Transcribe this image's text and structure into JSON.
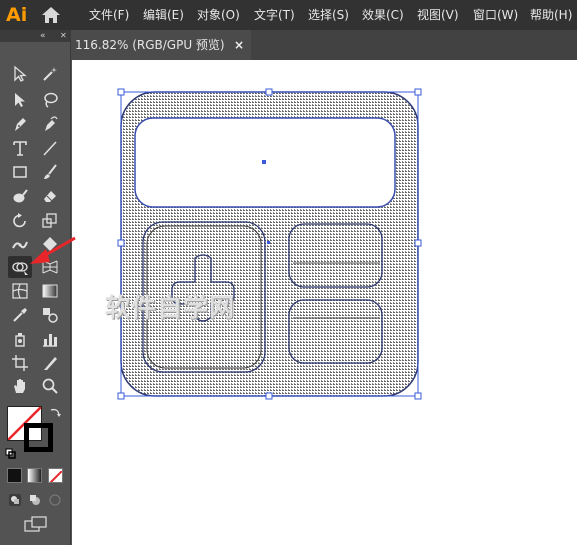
{
  "app": {
    "logo": "Ai"
  },
  "menu": [
    "文件(F)",
    "编辑(E)",
    "对象(O)",
    "文字(T)",
    "选择(S)",
    "效果(C)",
    "视图(V)",
    "窗口(W)",
    "帮助(H)"
  ],
  "document": {
    "title": "116.82% (RGB/GPU 预览)",
    "close_glyph": "×"
  },
  "toolbar": {
    "collapse_glyph": "«",
    "tools": [
      "selection-tool",
      "magic-wand-tool",
      "direct-selection-tool",
      "lasso-tool",
      "pen-tool",
      "curvature-tool",
      "type-tool",
      "line-segment-tool",
      "rectangle-tool",
      "paintbrush-tool",
      "blob-brush-tool",
      "eraser-tool",
      "rotate-tool",
      "scale-tool",
      "width-tool",
      "free-transform-tool",
      "shape-builder-tool",
      "perspective-grid-tool",
      "mesh-tool",
      "gradient-tool",
      "eyedropper-tool",
      "blend-tool",
      "symbol-sprayer-tool",
      "column-graph-tool",
      "artboard-tool",
      "slice-tool",
      "hand-tool",
      "zoom-tool"
    ],
    "active_tool": "shape-builder-tool",
    "fill_color": "none",
    "stroke_color": "#000000"
  },
  "watermark": "软件自学网",
  "colors": {
    "accent_selection": "#3a5bd9",
    "annotation_arrow": "#e8262a",
    "logo": "#ff9a00"
  }
}
